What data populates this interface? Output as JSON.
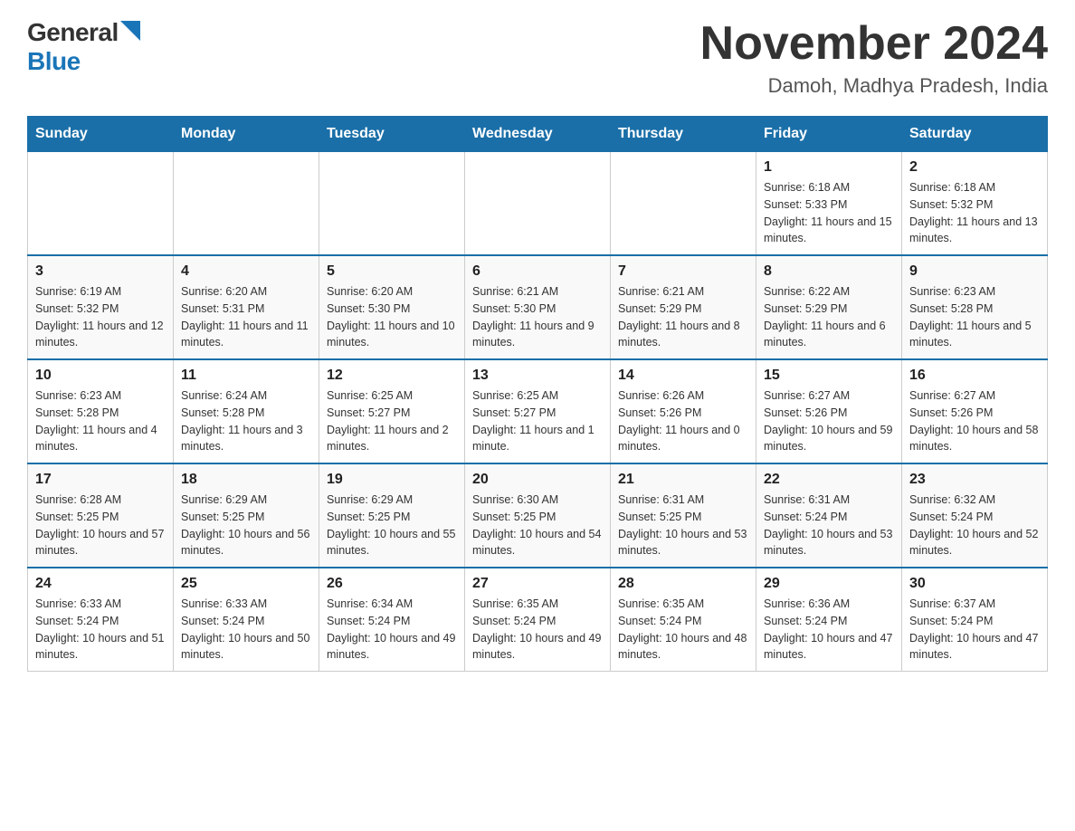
{
  "logo": {
    "general": "General",
    "blue": "Blue"
  },
  "title": {
    "month_year": "November 2024",
    "location": "Damoh, Madhya Pradesh, India"
  },
  "days_of_week": [
    "Sunday",
    "Monday",
    "Tuesday",
    "Wednesday",
    "Thursday",
    "Friday",
    "Saturday"
  ],
  "weeks": [
    [
      {
        "day": "",
        "sunrise": "",
        "sunset": "",
        "daylight": ""
      },
      {
        "day": "",
        "sunrise": "",
        "sunset": "",
        "daylight": ""
      },
      {
        "day": "",
        "sunrise": "",
        "sunset": "",
        "daylight": ""
      },
      {
        "day": "",
        "sunrise": "",
        "sunset": "",
        "daylight": ""
      },
      {
        "day": "",
        "sunrise": "",
        "sunset": "",
        "daylight": ""
      },
      {
        "day": "1",
        "sunrise": "Sunrise: 6:18 AM",
        "sunset": "Sunset: 5:33 PM",
        "daylight": "Daylight: 11 hours and 15 minutes."
      },
      {
        "day": "2",
        "sunrise": "Sunrise: 6:18 AM",
        "sunset": "Sunset: 5:32 PM",
        "daylight": "Daylight: 11 hours and 13 minutes."
      }
    ],
    [
      {
        "day": "3",
        "sunrise": "Sunrise: 6:19 AM",
        "sunset": "Sunset: 5:32 PM",
        "daylight": "Daylight: 11 hours and 12 minutes."
      },
      {
        "day": "4",
        "sunrise": "Sunrise: 6:20 AM",
        "sunset": "Sunset: 5:31 PM",
        "daylight": "Daylight: 11 hours and 11 minutes."
      },
      {
        "day": "5",
        "sunrise": "Sunrise: 6:20 AM",
        "sunset": "Sunset: 5:30 PM",
        "daylight": "Daylight: 11 hours and 10 minutes."
      },
      {
        "day": "6",
        "sunrise": "Sunrise: 6:21 AM",
        "sunset": "Sunset: 5:30 PM",
        "daylight": "Daylight: 11 hours and 9 minutes."
      },
      {
        "day": "7",
        "sunrise": "Sunrise: 6:21 AM",
        "sunset": "Sunset: 5:29 PM",
        "daylight": "Daylight: 11 hours and 8 minutes."
      },
      {
        "day": "8",
        "sunrise": "Sunrise: 6:22 AM",
        "sunset": "Sunset: 5:29 PM",
        "daylight": "Daylight: 11 hours and 6 minutes."
      },
      {
        "day": "9",
        "sunrise": "Sunrise: 6:23 AM",
        "sunset": "Sunset: 5:28 PM",
        "daylight": "Daylight: 11 hours and 5 minutes."
      }
    ],
    [
      {
        "day": "10",
        "sunrise": "Sunrise: 6:23 AM",
        "sunset": "Sunset: 5:28 PM",
        "daylight": "Daylight: 11 hours and 4 minutes."
      },
      {
        "day": "11",
        "sunrise": "Sunrise: 6:24 AM",
        "sunset": "Sunset: 5:28 PM",
        "daylight": "Daylight: 11 hours and 3 minutes."
      },
      {
        "day": "12",
        "sunrise": "Sunrise: 6:25 AM",
        "sunset": "Sunset: 5:27 PM",
        "daylight": "Daylight: 11 hours and 2 minutes."
      },
      {
        "day": "13",
        "sunrise": "Sunrise: 6:25 AM",
        "sunset": "Sunset: 5:27 PM",
        "daylight": "Daylight: 11 hours and 1 minute."
      },
      {
        "day": "14",
        "sunrise": "Sunrise: 6:26 AM",
        "sunset": "Sunset: 5:26 PM",
        "daylight": "Daylight: 11 hours and 0 minutes."
      },
      {
        "day": "15",
        "sunrise": "Sunrise: 6:27 AM",
        "sunset": "Sunset: 5:26 PM",
        "daylight": "Daylight: 10 hours and 59 minutes."
      },
      {
        "day": "16",
        "sunrise": "Sunrise: 6:27 AM",
        "sunset": "Sunset: 5:26 PM",
        "daylight": "Daylight: 10 hours and 58 minutes."
      }
    ],
    [
      {
        "day": "17",
        "sunrise": "Sunrise: 6:28 AM",
        "sunset": "Sunset: 5:25 PM",
        "daylight": "Daylight: 10 hours and 57 minutes."
      },
      {
        "day": "18",
        "sunrise": "Sunrise: 6:29 AM",
        "sunset": "Sunset: 5:25 PM",
        "daylight": "Daylight: 10 hours and 56 minutes."
      },
      {
        "day": "19",
        "sunrise": "Sunrise: 6:29 AM",
        "sunset": "Sunset: 5:25 PM",
        "daylight": "Daylight: 10 hours and 55 minutes."
      },
      {
        "day": "20",
        "sunrise": "Sunrise: 6:30 AM",
        "sunset": "Sunset: 5:25 PM",
        "daylight": "Daylight: 10 hours and 54 minutes."
      },
      {
        "day": "21",
        "sunrise": "Sunrise: 6:31 AM",
        "sunset": "Sunset: 5:25 PM",
        "daylight": "Daylight: 10 hours and 53 minutes."
      },
      {
        "day": "22",
        "sunrise": "Sunrise: 6:31 AM",
        "sunset": "Sunset: 5:24 PM",
        "daylight": "Daylight: 10 hours and 53 minutes."
      },
      {
        "day": "23",
        "sunrise": "Sunrise: 6:32 AM",
        "sunset": "Sunset: 5:24 PM",
        "daylight": "Daylight: 10 hours and 52 minutes."
      }
    ],
    [
      {
        "day": "24",
        "sunrise": "Sunrise: 6:33 AM",
        "sunset": "Sunset: 5:24 PM",
        "daylight": "Daylight: 10 hours and 51 minutes."
      },
      {
        "day": "25",
        "sunrise": "Sunrise: 6:33 AM",
        "sunset": "Sunset: 5:24 PM",
        "daylight": "Daylight: 10 hours and 50 minutes."
      },
      {
        "day": "26",
        "sunrise": "Sunrise: 6:34 AM",
        "sunset": "Sunset: 5:24 PM",
        "daylight": "Daylight: 10 hours and 49 minutes."
      },
      {
        "day": "27",
        "sunrise": "Sunrise: 6:35 AM",
        "sunset": "Sunset: 5:24 PM",
        "daylight": "Daylight: 10 hours and 49 minutes."
      },
      {
        "day": "28",
        "sunrise": "Sunrise: 6:35 AM",
        "sunset": "Sunset: 5:24 PM",
        "daylight": "Daylight: 10 hours and 48 minutes."
      },
      {
        "day": "29",
        "sunrise": "Sunrise: 6:36 AM",
        "sunset": "Sunset: 5:24 PM",
        "daylight": "Daylight: 10 hours and 47 minutes."
      },
      {
        "day": "30",
        "sunrise": "Sunrise: 6:37 AM",
        "sunset": "Sunset: 5:24 PM",
        "daylight": "Daylight: 10 hours and 47 minutes."
      }
    ]
  ]
}
